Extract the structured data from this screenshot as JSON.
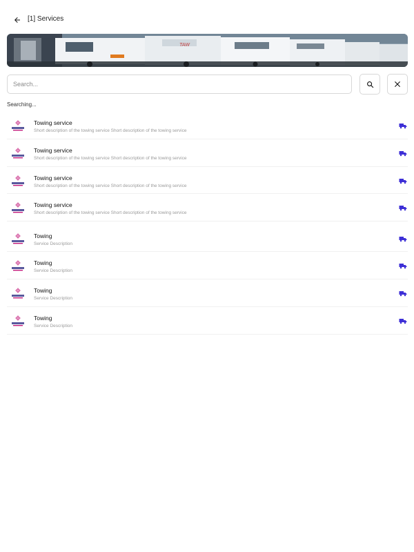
{
  "header": {
    "title": "[1] Services"
  },
  "search": {
    "placeholder": "Search..."
  },
  "status": "Searching...",
  "colors": {
    "accent": "#3d2fd6",
    "border": "#d7d7d7"
  },
  "services": [
    {
      "title": "Towing service",
      "description": "Short description of the towing service Short description of the towing service"
    },
    {
      "title": "Towing service",
      "description": "Short description of the towing service Short description of the towing service"
    },
    {
      "title": "Towing service",
      "description": "Short description of the towing service Short description of the towing service"
    },
    {
      "title": "Towing service",
      "description": "Short description of the towing service Short description of the towing service"
    },
    {
      "title": "Towing",
      "description": "Service Description"
    },
    {
      "title": "Towing",
      "description": "Service Description"
    },
    {
      "title": "Towing",
      "description": "Service Description"
    },
    {
      "title": "Towing",
      "description": "Service Description"
    }
  ],
  "icons": {
    "back": "arrow-left-icon",
    "search": "search-icon",
    "close": "close-icon",
    "truck": "truck-icon",
    "logo": "all-in-1-logo"
  }
}
